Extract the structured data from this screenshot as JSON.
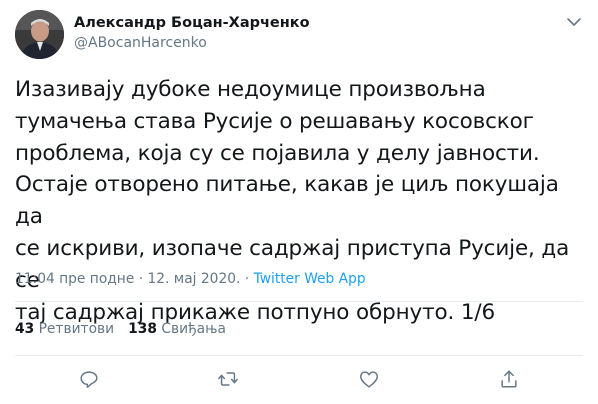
{
  "author": {
    "name": "Александр Боцан-Харченко",
    "handle": "@ABocanHarcenko"
  },
  "tweet": {
    "text": "Изазивају дубоке недоумице произвољна\nтумачења става Русије о решавању косовског\nпроблема, која су се појавила у делу јавности.\nОстаје отворено питање, какав је циљ покушаја да\nсе искриви, изопаче садржај приступа Русије, да се\nтај садржај прикаже потпуно обрнуто. 1/6",
    "time": "11:04 пре подне",
    "separator": "·",
    "date": "12. мај 2020.",
    "separator2": "·",
    "source": "Twitter Web App"
  },
  "stats": {
    "retweets_count": "43",
    "retweets_label": "Ретвитови",
    "likes_count": "138",
    "likes_label": "Свиђања"
  },
  "icons": {
    "reply": "reply-icon",
    "retweet": "retweet-icon",
    "like": "heart-icon",
    "share": "share-icon",
    "menu": "chevron-down-icon"
  },
  "colors": {
    "accent": "#1da1f2",
    "secondary_text": "#657786",
    "primary_text": "#14171a",
    "divider": "#e6ecf0"
  }
}
